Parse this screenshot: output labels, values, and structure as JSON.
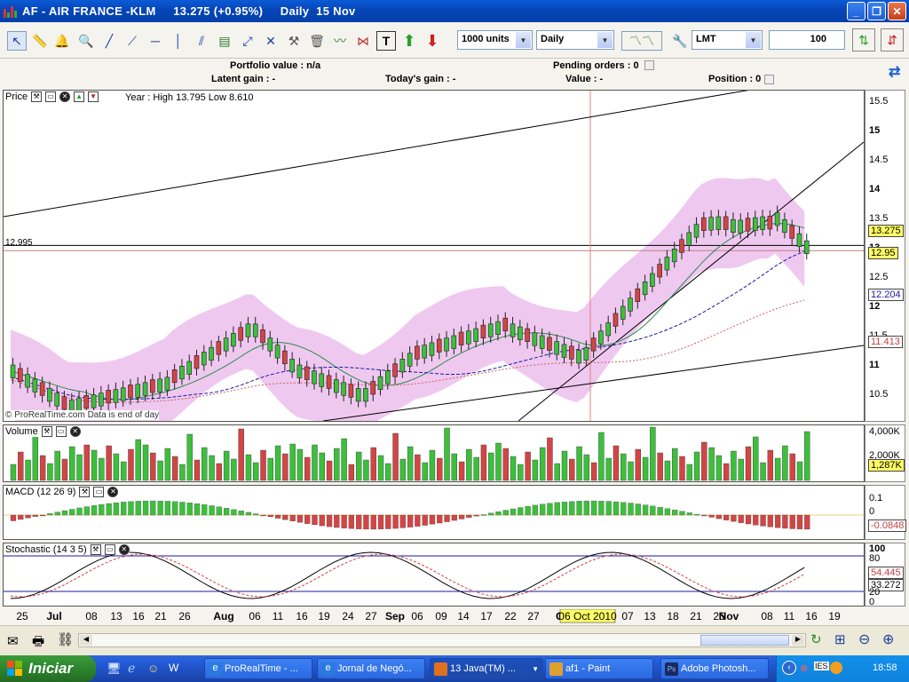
{
  "window": {
    "title": "AF - AIR FRANCE -KLM     13.275 (+0.95%)     Daily  15 Nov"
  },
  "toolbar": {
    "quantity": "1000 units",
    "period": "Daily",
    "order_type": "LMT",
    "order_qty": "100"
  },
  "info": {
    "portfolio_value": "Portfolio value : n/a",
    "latent_gain": "Latent gain : -",
    "todays_gain": "Today's gain : -",
    "pending_orders": "Pending orders : 0",
    "value": "Value : -",
    "position": "Position : 0"
  },
  "price_panel": {
    "label": "Price",
    "year_text": "Year : High 13.795 Low 8.610",
    "left_level": "12.995",
    "copyright": "© ProRealTime.com  Data is end of day",
    "yticks": [
      "15.5",
      "15",
      "14.5",
      "14",
      "13.5",
      "13",
      "12.5",
      "12",
      "11.5",
      "11",
      "10.5"
    ],
    "tags": {
      "last": "13.275",
      "ma20": "12.95",
      "ma50": "12.204",
      "ma100": "11.413"
    }
  },
  "volume_panel": {
    "label": "Volume",
    "yticks": [
      "4,000K",
      "2,000K"
    ],
    "tag": "1,287K"
  },
  "macd_panel": {
    "label": "MACD (12 26 9)",
    "yticks": [
      "0.1",
      "0"
    ],
    "tag": "-0.0848"
  },
  "stoch_panel": {
    "label": "Stochastic (14 3 5)",
    "yticks": [
      "100",
      "80",
      "20",
      "0"
    ],
    "tags": [
      "54.445",
      "33.272"
    ]
  },
  "xaxis": {
    "labels": [
      "25",
      "Jul",
      "08",
      "13",
      "16",
      "21",
      "26",
      "Aug",
      "06",
      "11",
      "16",
      "19",
      "24",
      "27",
      "Sep",
      "06",
      "09",
      "14",
      "17",
      "22",
      "27",
      "Oct",
      "07",
      "13",
      "18",
      "21",
      "26",
      "Nov",
      "08",
      "11",
      "16",
      "19"
    ],
    "cursor_label": "06 Oct 2010"
  },
  "taskbar": {
    "start": "Iniciar",
    "tasks": [
      "ProRealTime - ...",
      "Jornal de Negó...",
      "13 Java(TM) ...",
      "af1 - Paint",
      "Adobe Photosh..."
    ],
    "lang": "PT",
    "clock": "18:58"
  },
  "colors": {
    "up": "#3cc03c",
    "down": "#d34545",
    "band": "#efc8f0",
    "accent": "#0a5bd6"
  }
}
